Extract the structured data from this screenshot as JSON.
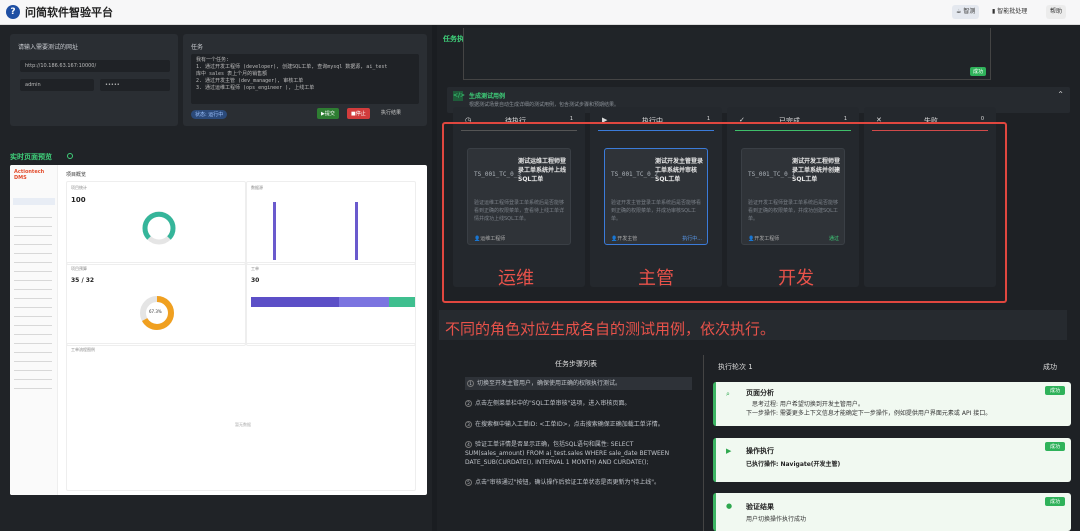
{
  "app": {
    "title": "问简软件智验平台",
    "btn1": "智测",
    "btn2": "智能批处理",
    "btn3": "帮助"
  },
  "left": {
    "url_label": "请输入需要测试的网址",
    "url_value": "http://10.186.63.167:10000/",
    "user_value": "admin",
    "pass_value": "•••••",
    "task_label": "任务",
    "task_lines": [
      "我有一个任务:",
      "1. 通过开发工程师 (developer), 创建SQL工单, 查询mysql 数据源, ai_test",
      "库中 sales 表上个月的销售额",
      "2. 通过开发主管 (dev_manager), 审核工单",
      "3. 通过运维工程师 (ops_engineer ), 上线工单"
    ],
    "status": "状态: 运行中",
    "submit": "▶提交",
    "stop": "■停止",
    "exec_result": "执行结果",
    "preview_title": "实时页面预览",
    "dms": {
      "brand": "Actiontech DMS",
      "header": "项目概览",
      "card1": "项目统计",
      "card1_val": "100",
      "card2": "数据源",
      "card3": "项目预算",
      "card3_val": "35 / 32",
      "card4": "工单",
      "card4_val": "30",
      "donut_val": "67.3%",
      "card5": "工单流程图例",
      "empty": "暂无数据"
    }
  },
  "right": {
    "flow_title": "任务执行流程",
    "success_tag": "成功",
    "gen_title": "生成测试用例",
    "gen_desc": "根据测试场景自动生成详细的测试用例，包含测试步骤和预期结果。",
    "columns": [
      {
        "title": "待执行",
        "count": "1",
        "id": "TS_001_TC_0_3",
        "name": "测试运维工程师登录工单系统并上线SQL工单",
        "desc": "验证运维工程师登录工单系统后是否能够看到正确的权限菜单，查看待上线工单详情并成功上线SQL工单。",
        "foot": "运维工程师",
        "word": "运维"
      },
      {
        "title": "执行中",
        "count": "1",
        "id": "TS_001_TC_0_2",
        "name": "测试开发主管登录工单系统并审核SQL工单",
        "desc": "验证开发主管登录工单系统后是否能够看到正确的权限菜单，并成功审核SQL工单。",
        "foot": "开发主管",
        "status": "执行中...",
        "word": "主管"
      },
      {
        "title": "已完成",
        "count": "1",
        "id": "TS_001_TC_0_1",
        "name": "测试开发工程师登录工单系统并创建SQL工单",
        "desc": "验证开发工程师登录工单系统后是否能够看到正确的权限菜单，并成功创建SQL工单。",
        "foot": "开发工程师",
        "status": "通过",
        "word": "开发"
      },
      {
        "title": "失败",
        "count": "0"
      }
    ],
    "annotation": "不同的角色对应生成各自的测试用例，依次执行。",
    "steps_title": "任务步骤列表",
    "steps": [
      "切换至开发主管用户，确保使用正确的权限执行测试。",
      "点击左侧菜单栏中的\"SQL工单审核\"选项，进入审核页面。",
      "在搜索框中输入工单ID: <工单ID>，点击搜索确保正确加载工单详情。",
      "验证工单详情是否显示正确，包括SQL语句和属性: SELECT SUM(sales_amount) FROM ai_test.sales WHERE sale_date BETWEEN DATE_SUB(CURDATE(), INTERVAL 1 MONTH) AND CURDATE();",
      "点击\"审核通过\"按钮，确认操作后验证工单状态是否更新为\"待上线\"。"
    ],
    "round_title": "执行轮次 1",
    "round_status": "成功",
    "results": [
      {
        "title": "页面分析",
        "l1": "思考过程: 用户希望切换到开发主管用户。",
        "l2": "下一步操作: 需要更多上下文信息才能确定下一步操作，例如提供用户界面元素或 API 接口。",
        "tag": "成功"
      },
      {
        "title": "操作执行",
        "l1": "已执行操作: Navigate(开发主管)",
        "tag": "成功"
      },
      {
        "title": "验证结果",
        "l1": "用户切换操作执行成功",
        "tag": "成功"
      }
    ]
  }
}
